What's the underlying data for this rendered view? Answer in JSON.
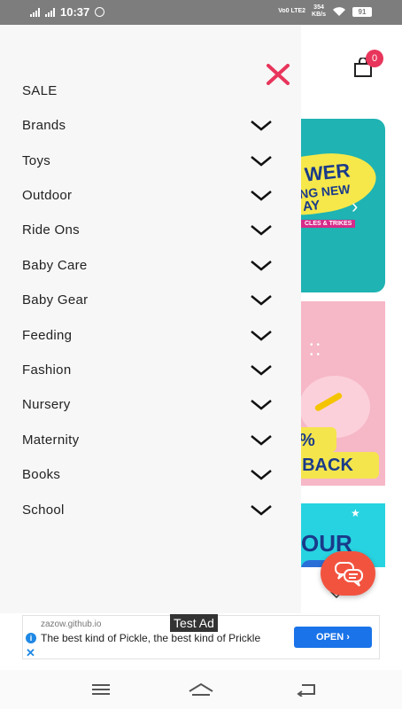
{
  "status_bar": {
    "time": "10:37",
    "network_top": "Vo0 LTE2",
    "speed": "354",
    "speed_unit": "KB/s",
    "battery": "91"
  },
  "background": {
    "cart_count": "0",
    "banner1": {
      "line1": "WER",
      "line2": "NG NEW",
      "line3": "AY",
      "tag": "CLES & TRIKES"
    },
    "banner2": {
      "line1": "%",
      "line2": "I BACK"
    },
    "banner3": {
      "line1": "OUR"
    }
  },
  "drawer": {
    "sale_label": "SALE",
    "items": [
      {
        "label": "Brands"
      },
      {
        "label": "Toys"
      },
      {
        "label": "Outdoor"
      },
      {
        "label": "Ride Ons"
      },
      {
        "label": "Baby Care"
      },
      {
        "label": "Baby Gear"
      },
      {
        "label": "Feeding"
      },
      {
        "label": "Fashion"
      },
      {
        "label": "Nursery"
      },
      {
        "label": "Maternity"
      },
      {
        "label": "Books"
      },
      {
        "label": "School"
      }
    ]
  },
  "ad": {
    "url": "zazow.github.io",
    "text": "The best kind of Pickle, the best kind of Prickle",
    "button_label": "OPEN",
    "test_label": "Test Ad"
  },
  "colors": {
    "accent": "#e8355b",
    "chat_fab": "#f2533f",
    "ad_button": "#1a73e8"
  }
}
